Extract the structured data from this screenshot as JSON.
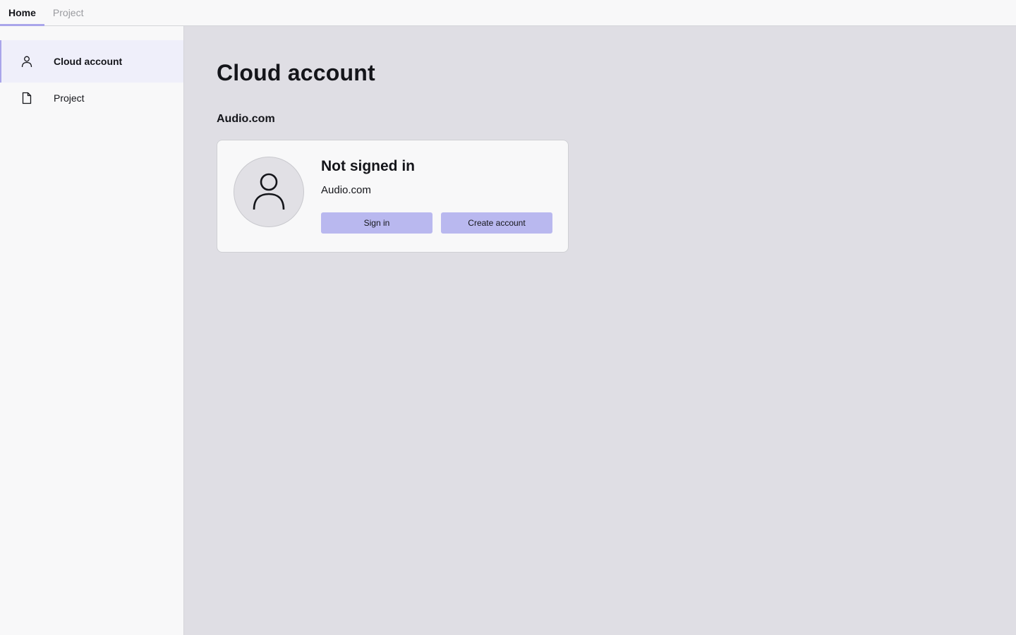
{
  "tabs": [
    {
      "label": "Home",
      "active": true
    },
    {
      "label": "Project",
      "active": false
    }
  ],
  "sidebar": {
    "items": [
      {
        "label": "Cloud account",
        "icon": "person-icon",
        "active": true
      },
      {
        "label": "Project",
        "icon": "file-icon",
        "active": false
      }
    ]
  },
  "main": {
    "title": "Cloud account",
    "section_title": "Audio.com",
    "card": {
      "status": "Not signed in",
      "service": "Audio.com",
      "sign_in_label": "Sign in",
      "create_account_label": "Create account"
    }
  },
  "colors": {
    "accent": "#a9a5ea",
    "button": "#b9b8ef",
    "background": "#dfdee4",
    "panel": "#f8f8f9"
  }
}
